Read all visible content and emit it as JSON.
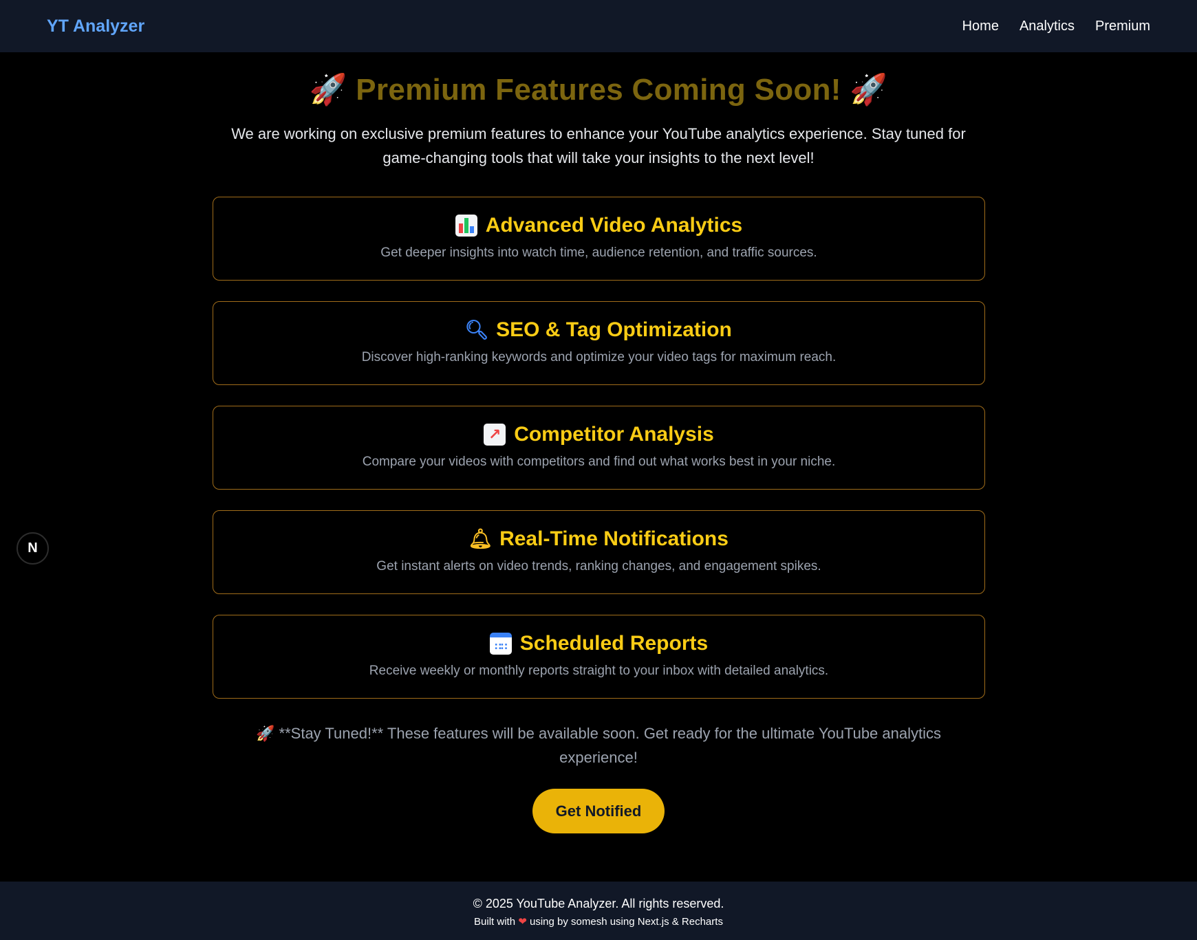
{
  "navbar": {
    "brand": "YT Analyzer",
    "links": [
      "Home",
      "Analytics",
      "Premium"
    ]
  },
  "hero": {
    "title": "Premium Features Coming Soon!",
    "title_emoji": "🚀",
    "description": "We are working on exclusive premium features to enhance your YouTube analytics experience. Stay tuned for game-changing tools that will take your insights to the next level!"
  },
  "features": [
    {
      "icon": "bar-chart-icon",
      "title": "Advanced Video Analytics",
      "description": "Get deeper insights into watch time, audience retention, and traffic sources."
    },
    {
      "icon": "magnifier-icon",
      "title": "SEO & Tag Optimization",
      "description": "Discover high-ranking keywords and optimize your video tags for maximum reach."
    },
    {
      "icon": "trend-chart-icon",
      "title": "Competitor Analysis",
      "description": "Compare your videos with competitors and find out what works best in your niche."
    },
    {
      "icon": "bell-icon",
      "title": "Real-Time Notifications",
      "description": "Get instant alerts on video trends, ranking changes, and engagement spikes."
    },
    {
      "icon": "calendar-icon",
      "title": "Scheduled Reports",
      "description": "Receive weekly or monthly reports straight to your inbox with detailed analytics."
    }
  ],
  "stay_tuned": {
    "emoji": "🚀",
    "text": "**Stay Tuned!** These features will be available soon. Get ready for the ultimate YouTube analytics experience!"
  },
  "cta_label": "Get Notified",
  "dev_badge": "N",
  "footer": {
    "copyright": "© 2025 YouTube Analyzer. All rights reserved.",
    "built_prefix": "Built with",
    "heart": "❤",
    "built_suffix": "using by somesh using Next.js & Recharts"
  },
  "colors": {
    "background": "#000000",
    "navbar": "#111827",
    "brand": "#60a5fa",
    "accent": "#facc15",
    "card_border": "#a16d1a",
    "button": "#eab308"
  }
}
